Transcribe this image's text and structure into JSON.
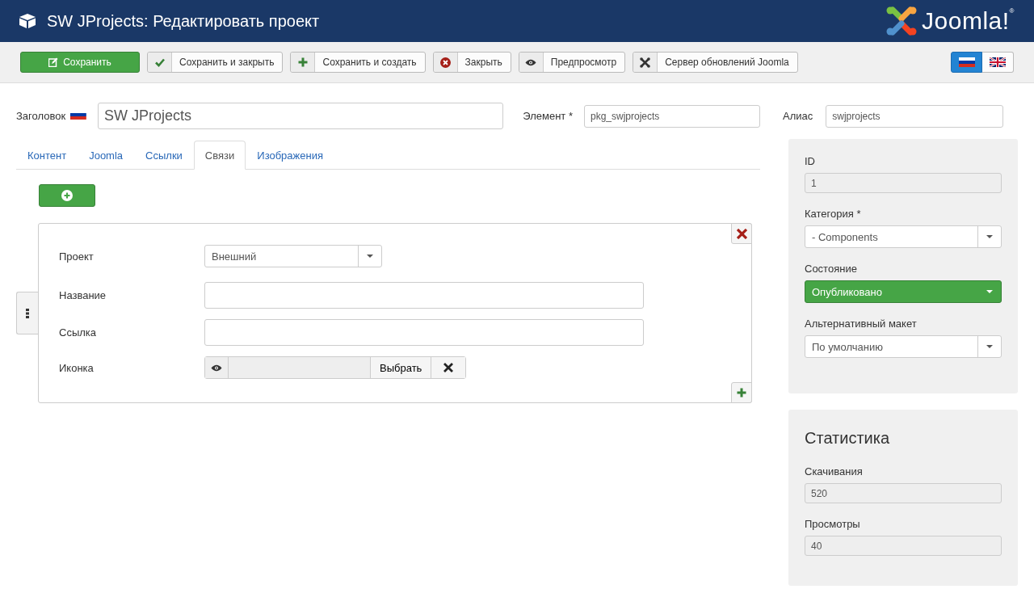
{
  "header": {
    "title": "SW JProjects: Редактировать проект",
    "logo_text": "Joomla!$^{®}$"
  },
  "toolbar": {
    "buttons": [
      {
        "label": "Сохранить",
        "kind": "primary"
      },
      {
        "label": "Сохранить и закрыть",
        "kind": "default"
      },
      {
        "label": "Сохранить и создать",
        "kind": "default"
      },
      {
        "label": "Закрыть",
        "kind": "default"
      },
      {
        "label": "Предпросмотр",
        "kind": "default"
      },
      {
        "label": "Сервер обновлений Joomla",
        "kind": "default"
      }
    ],
    "languages": [
      {
        "selected": true
      },
      {
        "selected": false
      }
    ]
  },
  "top_fields": {
    "title_label": "Заголовок",
    "title_value": "SW JProjects",
    "element_label": "Элемент *",
    "element_value": "pkg_swjprojects",
    "alias_label": "Алиас",
    "alias_value": "swjprojects"
  },
  "tabs": [
    {
      "label": "Контент",
      "selected": false
    },
    {
      "label": "Joomla",
      "selected": false
    },
    {
      "label": "Ссылки",
      "selected": false
    },
    {
      "label": "Связи",
      "selected": true
    },
    {
      "label": "Изображения",
      "selected": false
    }
  ],
  "relation": {
    "fields": [
      {
        "label": "Проект",
        "kind": "select",
        "value": "Внешний"
      },
      {
        "label": "Название",
        "kind": "text"
      },
      {
        "label": "Ссылка",
        "kind": "text"
      },
      {
        "label": "Иконка",
        "kind": "media",
        "button": "Выбрать"
      }
    ]
  },
  "sidebar": {
    "fields": [
      {
        "label": "ID",
        "kind": "readonly",
        "value": "1"
      },
      {
        "label": "Категория *",
        "kind": "select",
        "value": "- Components"
      },
      {
        "label": "Состояние",
        "kind": "status",
        "value": "Опубликовано"
      },
      {
        "label": "Альтернативный макет",
        "kind": "select",
        "value": "По умолчанию"
      }
    ]
  },
  "statistics": {
    "heading": "Статистика",
    "fields": [
      {
        "label": "Скачивания",
        "kind": "readonly",
        "value": "520"
      },
      {
        "label": "Просмотры",
        "kind": "readonly",
        "value": "40"
      }
    ]
  }
}
